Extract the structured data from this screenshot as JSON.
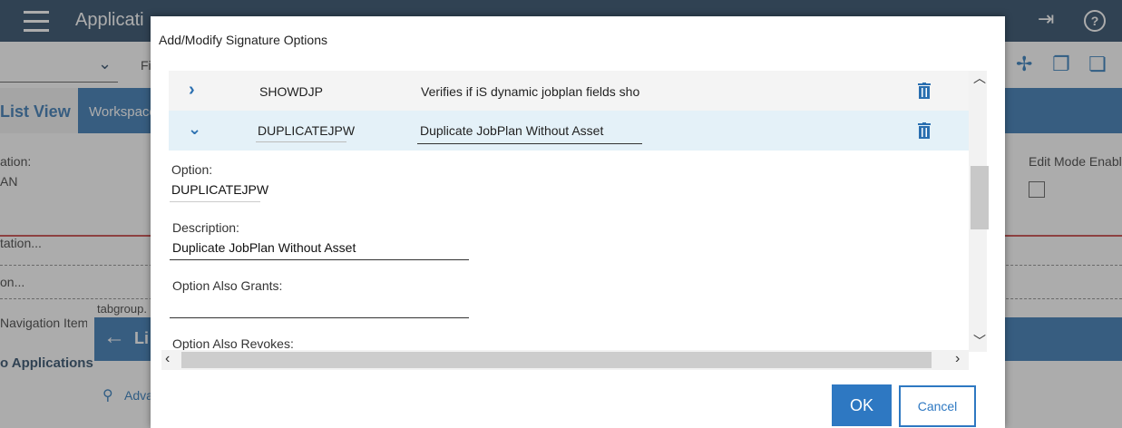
{
  "background": {
    "app_title": "Applicati",
    "list_view_tab": "List View",
    "workspace_tab": "Workspace",
    "filter_label": "Fi",
    "option_label": "ation:",
    "option_value": "AN",
    "edit_mode_label": "Edit Mode Enable",
    "link_1": "tation...",
    "link_2": "on...",
    "nav_item": "Navigation Item",
    "tabgroup": "tabgroup.",
    "applications": "o Applications",
    "advanced": "Adva",
    "list_head": "Li"
  },
  "dialog": {
    "title": "Add/Modify Signature Options",
    "rows": [
      {
        "option": "SHOWDJP",
        "description": "Verifies if iS dynamic jobplan fields sho",
        "expanded": false
      },
      {
        "option": "DUPLICATEJPW",
        "description": "Duplicate JobPlan Without Asset",
        "expanded": true
      }
    ],
    "details": {
      "option_label": "Option:",
      "option_value": "DUPLICATEJPW",
      "description_label": "Description:",
      "description_value": "Duplicate JobPlan Without Asset",
      "grants_label": "Option Also Grants:",
      "grants_value": "",
      "revokes_label": "Option Also Revokes:"
    },
    "ok_label": "OK",
    "cancel_label": "Cancel"
  },
  "colors": {
    "primary": "#2e78c2",
    "header": "#1e3e5e",
    "selected_row": "#e4f1f8"
  }
}
